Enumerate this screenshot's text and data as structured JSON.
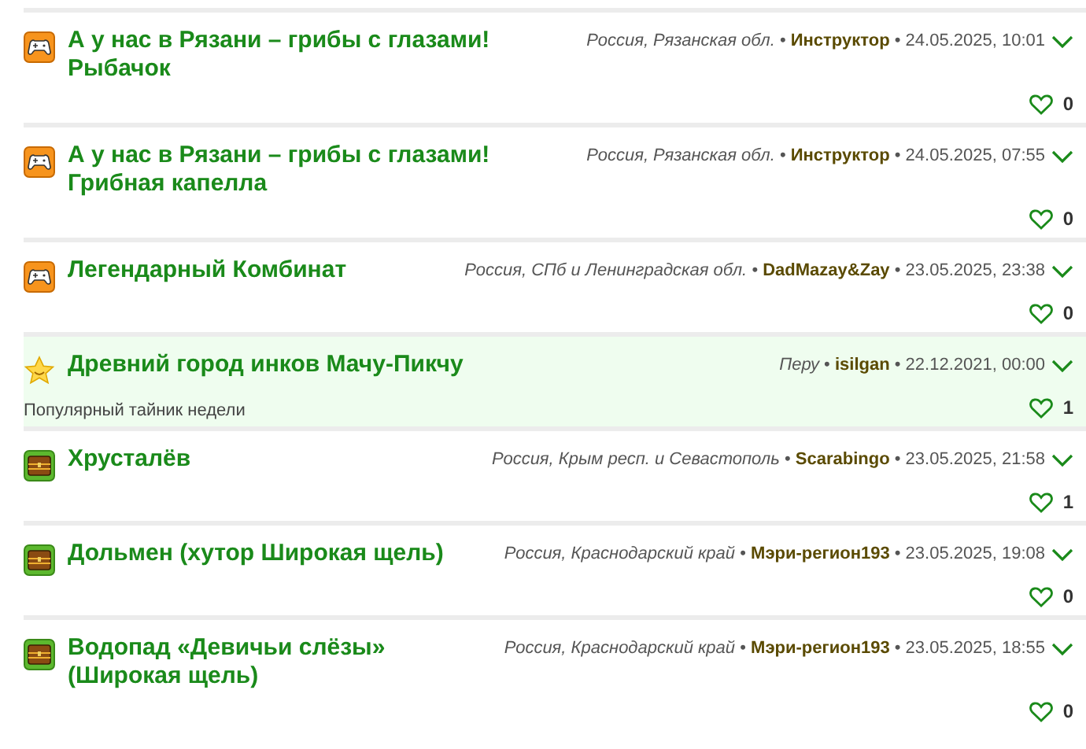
{
  "separator": "•",
  "items": [
    {
      "kind": "game",
      "title": "А у нас в Рязани – грибы с глазами! Рыбачок",
      "region": "Россия, Рязанская обл.",
      "author": "Инструктор",
      "date": "24.05.2025, 10:01",
      "likes": "0",
      "highlighted": false
    },
    {
      "kind": "game",
      "title": "А у нас в Рязани – грибы с глазами! Грибная капелла",
      "region": "Россия, Рязанская обл.",
      "author": "Инструктор",
      "date": "24.05.2025, 07:55",
      "likes": "0",
      "highlighted": false
    },
    {
      "kind": "game",
      "title": "Легендарный Комбинат",
      "region": "Россия, СПб и Ленинградская обл.",
      "author": "DadMazay&Zay",
      "date": "23.05.2025, 23:38",
      "likes": "0",
      "highlighted": false
    },
    {
      "kind": "star",
      "title": "Древний город инков Мачу-Пикчу",
      "region": "Перу",
      "author": "isilgan",
      "date": "22.12.2021, 00:00",
      "likes": "1",
      "highlighted": true,
      "note": "Популярный тайник недели"
    },
    {
      "kind": "chest",
      "title": "Хрусталёв",
      "region": "Россия, Крым респ. и Севастополь",
      "author": "Scarabingo",
      "date": "23.05.2025, 21:58",
      "likes": "1",
      "highlighted": false
    },
    {
      "kind": "chest",
      "title": "Дольмен (хутор Широкая щель)",
      "region": "Россия, Краснодарский край",
      "author": "Мэри-регион193",
      "date": "23.05.2025, 19:08",
      "likes": "0",
      "highlighted": false
    },
    {
      "kind": "chest",
      "title": "Водопад «Девичьи слёзы» (Широкая щель)",
      "region": "Россия, Краснодарский край",
      "author": "Мэри-регион193",
      "date": "23.05.2025, 18:55",
      "likes": "0",
      "highlighted": false
    }
  ]
}
